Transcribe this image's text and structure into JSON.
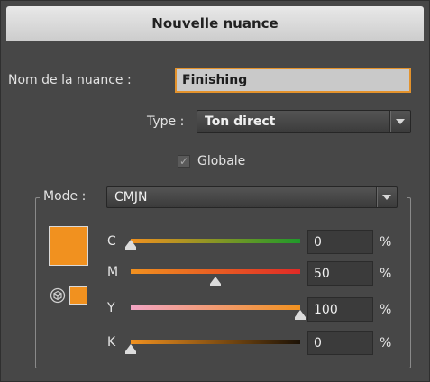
{
  "dialog": {
    "title": "Nouvelle nuance"
  },
  "name_field": {
    "label": "Nom de la nuance :",
    "value": "Finishing"
  },
  "type_field": {
    "label": "Type :",
    "value": "Ton direct"
  },
  "globale": {
    "label": "Globale",
    "checked": true,
    "check_glyph": "✓"
  },
  "mode": {
    "label": "Mode :",
    "value": "CMJN"
  },
  "swatch_color": "#f1911f",
  "channels": [
    {
      "letter": "C",
      "value": "0",
      "unit": "%",
      "gradient_end": "#1f9a2a"
    },
    {
      "letter": "M",
      "value": "50",
      "unit": "%",
      "gradient_end": "#e02a26"
    },
    {
      "letter": "Y",
      "value": "100",
      "unit": "%",
      "gradient_end": "#f2a5c4"
    },
    {
      "letter": "K",
      "value": "0",
      "unit": "%",
      "gradient_end": "#1c1206"
    }
  ],
  "icons": {
    "dropdown_arrow": "chevron-down-icon",
    "out_of_gamut": "cube-icon"
  }
}
